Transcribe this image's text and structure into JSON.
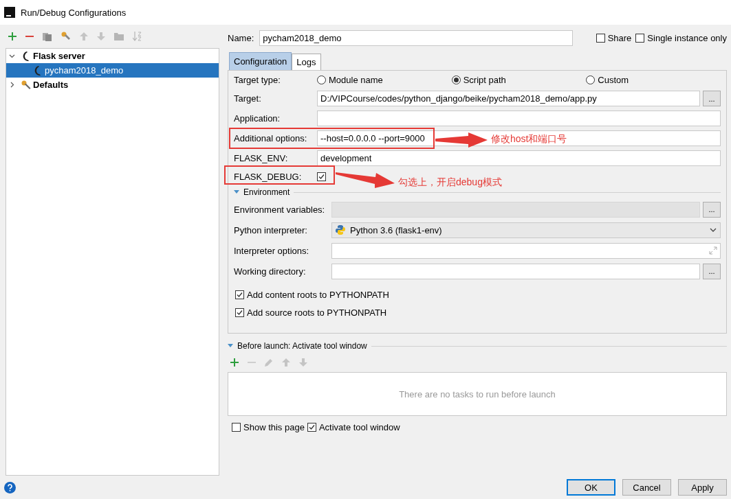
{
  "window": {
    "title": "Run/Debug Configurations"
  },
  "tree": [
    {
      "label": "Flask server",
      "kind": "flask",
      "expanded": true,
      "selected": false,
      "children": [
        {
          "label": "pycham2018_demo",
          "kind": "flask",
          "selected": true
        }
      ]
    },
    {
      "label": "Defaults",
      "kind": "defaults",
      "expanded": false,
      "selected": false
    }
  ],
  "name": {
    "label": "Name:",
    "value": "pycham2018_demo"
  },
  "options": [
    {
      "label": "Share",
      "checked": false
    },
    {
      "label": "Single instance only",
      "checked": false
    }
  ],
  "tabs": [
    {
      "label": "Configuration",
      "selected": true
    },
    {
      "label": "Logs",
      "selected": false
    }
  ],
  "target_type": {
    "label": "Target type:",
    "options": [
      {
        "label": "Module name",
        "selected": false
      },
      {
        "label": "Script path",
        "selected": true
      },
      {
        "label": "Custom",
        "selected": false
      }
    ]
  },
  "fields": [
    {
      "kind": "browse",
      "label": "Target:",
      "value": "D:/VIPCourse/codes/python_django/beike/pycham2018_demo/app.py",
      "button": "..."
    },
    {
      "kind": "text",
      "label": "Application:"
    },
    {
      "kind": "text",
      "label": "Additional options:",
      "value": "--host=0.0.0.0 --port=9000"
    },
    {
      "kind": "text",
      "label": "FLASK_ENV:",
      "value": "development"
    },
    {
      "kind": "check",
      "label": "FLASK_DEBUG:",
      "checked": true
    }
  ],
  "environment": {
    "label": "Environment",
    "expanded": true,
    "fields": [
      {
        "kind": "browse",
        "label": "Environment variables:",
        "disabled": true,
        "button": "..."
      },
      {
        "kind": "combo",
        "label": "Python interpreter:",
        "value": "Python 3.6 (flask1-env)"
      },
      {
        "kind": "expand",
        "label": "Interpreter options:"
      },
      {
        "kind": "browse",
        "label": "Working directory:",
        "disabled": false,
        "button": "..."
      }
    ]
  },
  "path_options": [
    {
      "label": "Add content roots to PYTHONPATH",
      "checked": true
    },
    {
      "label": "Add source roots to PYTHONPATH",
      "checked": true
    }
  ],
  "before_launch": {
    "label": "Before launch: Activate tool window",
    "expanded": true,
    "empty_text": "There are no tasks to run before launch"
  },
  "bottom_options": [
    {
      "label": "Show this page",
      "checked": false
    },
    {
      "label": "Activate tool window",
      "checked": true
    }
  ],
  "buttons": [
    {
      "label": "OK",
      "default": true
    },
    {
      "label": "Cancel",
      "default": false
    },
    {
      "label": "Apply",
      "default": false
    }
  ],
  "annotations": [
    {
      "text": "修改host和端口号"
    },
    {
      "text": "勾选上，开启debug模式"
    }
  ]
}
